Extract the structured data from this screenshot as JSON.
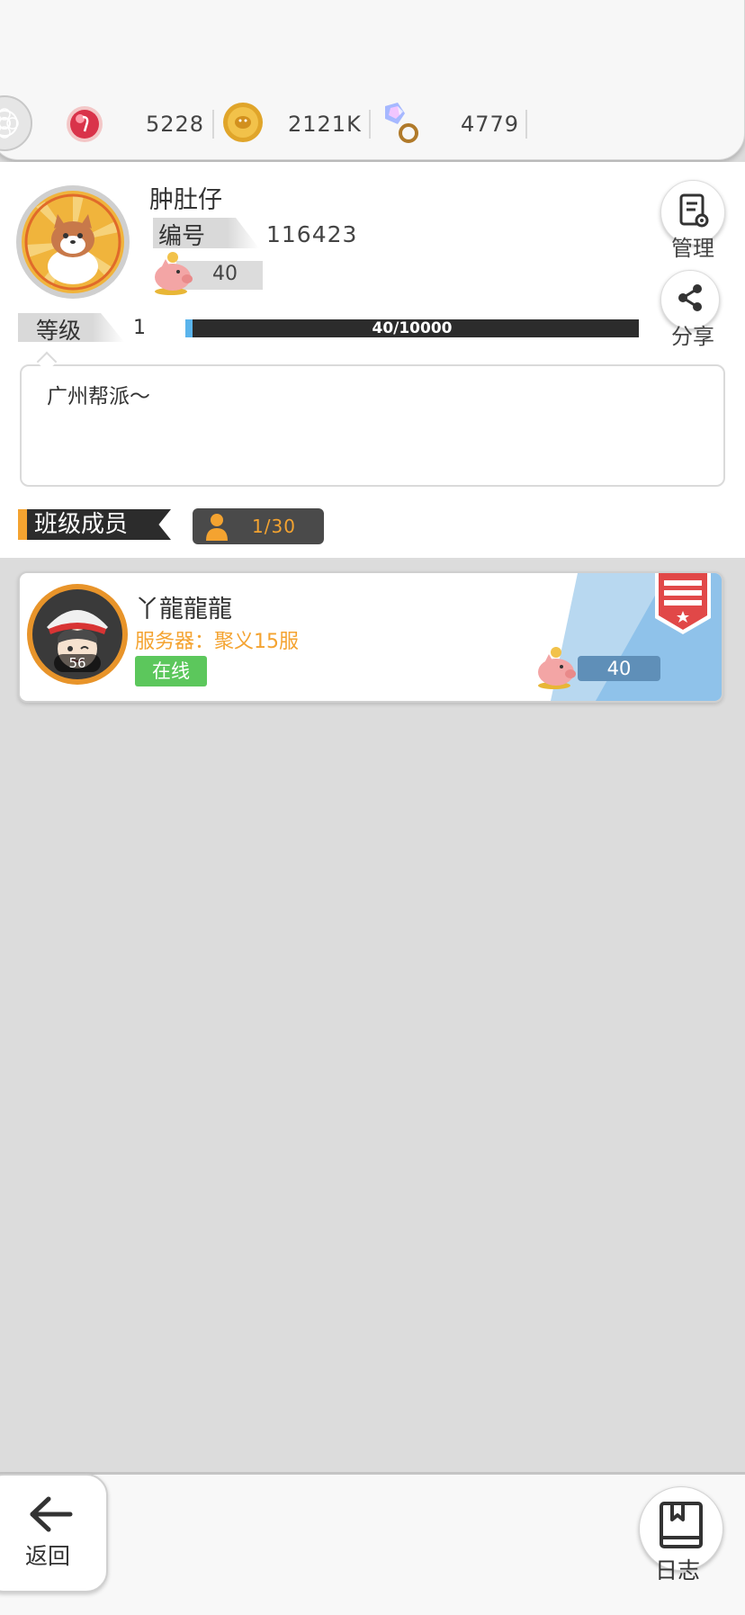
{
  "currencies": [
    {
      "icon": "ruby-icon",
      "value": "5228"
    },
    {
      "icon": "gold-coin-icon",
      "value": "2121K"
    },
    {
      "icon": "crystal-ring-icon",
      "value": "4779"
    }
  ],
  "profile": {
    "name": "肿肚仔",
    "id_label": "编号",
    "id_value": "116423",
    "piggy_value": "40",
    "level_label": "等级",
    "level_value": "1",
    "exp_text": "40/10000",
    "exp_fraction": 0.004,
    "bio": "广州帮派～"
  },
  "actions": {
    "manage_label": "管理",
    "share_label": "分享"
  },
  "members_section": {
    "title": "班级成员",
    "count": "1/30"
  },
  "members": [
    {
      "name": "丫龍龍龍",
      "avatar_level": "56",
      "server": "服务器：聚义15服",
      "status": "在线",
      "piggy_value": "40"
    }
  ],
  "bottom": {
    "back_label": "返回",
    "log_label": "日志"
  },
  "colors": {
    "accent_orange": "#f4a330",
    "online_green": "#5cc75c",
    "exp_bar": "#2c2c2c",
    "exp_fill": "#5ab4ec",
    "card_blue": "#8fc2ea",
    "badge_red": "#e14848"
  }
}
